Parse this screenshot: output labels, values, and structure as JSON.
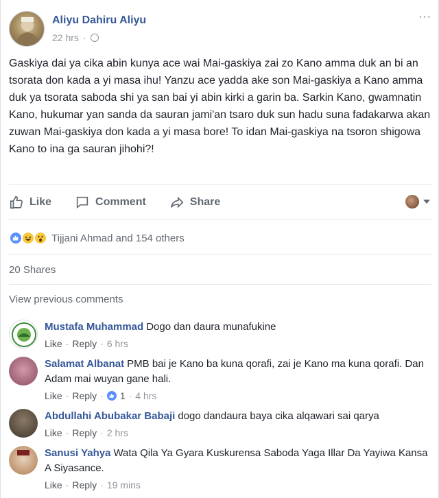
{
  "post": {
    "author": "Aliyu Dahiru Aliyu",
    "time": "22 hrs",
    "separator": "·",
    "more": "···",
    "text": "Gaskiya dai ya cika abin kunya ace wai Mai-gaskiya zai zo Kano amma duk an bi an tsorata don kada a yi masa ihu! Yanzu ace yadda ake son Mai-gaskiya a Kano amma duk ya tsorata saboda shi ya san bai yi abin kirki a garin ba. Sarkin Kano, gwamnatin Kano, hukumar yan sanda da sauran jami'an tsaro duk sun hadu suna fadakarwa akan zuwan Mai-gaskiya don kada a yi masa bore! To idan Mai-gaskiya na tsoron shigowa Kano to ina ga sauran jihohi?!"
  },
  "actions": {
    "like": "Like",
    "comment": "Comment",
    "share": "Share"
  },
  "reactions": {
    "text": "Tijjani Ahmad and 154 others",
    "icons": [
      "like-icon",
      "haha-icon",
      "wow-icon"
    ]
  },
  "shares": "20 Shares",
  "view_previous": "View previous comments",
  "comments": [
    {
      "name": "Mustafa Muhammad",
      "text": "Dogo dan daura munafukine",
      "like": "Like",
      "reply": "Reply",
      "time": "6 hrs",
      "likes": ""
    },
    {
      "name": "Salamat Albanat",
      "text": "PMB bai je Kano ba kuna qorafi, zai je Kano ma kuna qorafi. Dan Adam mai wuyan gane hali.",
      "like": "Like",
      "reply": "Reply",
      "time": "4 hrs",
      "likes": "1"
    },
    {
      "name": "Abdullahi Abubakar Babaji",
      "text": "dogo dandaura baya cika alqawari sai qarya",
      "like": "Like",
      "reply": "Reply",
      "time": "2 hrs",
      "likes": ""
    },
    {
      "name": "Sanusi Yahya",
      "text": "Wata Qila Ya Gyara Kuskurensa Saboda Yaga Illar Da Yayiwa Kansa A Siyasance.",
      "like": "Like",
      "reply": "Reply",
      "time": "19 mins",
      "likes": ""
    }
  ],
  "link_dot": "·",
  "colors": {
    "name_blue": "#365899",
    "like_blue": "#5890ff",
    "muted": "#90949c"
  }
}
